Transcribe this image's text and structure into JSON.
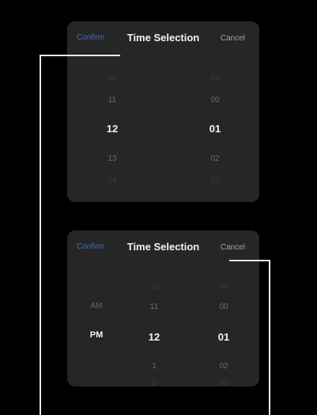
{
  "pickers": [
    {
      "header": {
        "confirm": "Confirm",
        "title": "Time Selection",
        "cancel": "Cancel"
      },
      "hours": [
        "10",
        "11",
        "12",
        "13",
        "14"
      ],
      "minutes": [
        "59",
        "00",
        "01",
        "02",
        "03"
      ]
    },
    {
      "header": {
        "confirm": "Confirm",
        "title": "Time Selection",
        "cancel": "Cancel"
      },
      "ampm": [
        "AM",
        "PM"
      ],
      "hours": [
        "10",
        "11",
        "12",
        "1",
        "2"
      ],
      "minutes": [
        "59",
        "00",
        "01",
        "02",
        "03"
      ]
    }
  ],
  "colors": {
    "background": "#000000",
    "panel": "#262626",
    "confirm": "#3f6fb4",
    "selected": "#f2f2f2",
    "connector": "#e8e8e8"
  }
}
